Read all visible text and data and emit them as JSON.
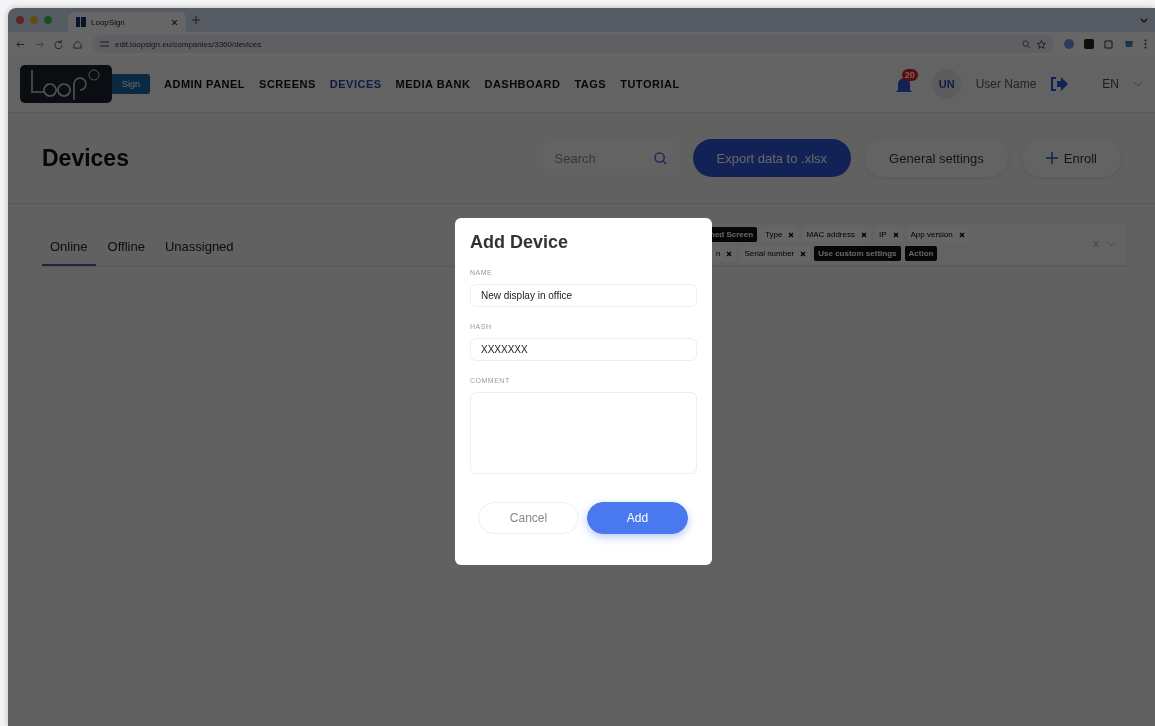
{
  "browser": {
    "tab_title": "LoopSign",
    "url": "edit.loopsign.eu/companies/3360/devices"
  },
  "header": {
    "logo_badge": "Sign",
    "nav": [
      {
        "label": "ADMIN PANEL",
        "selected": false
      },
      {
        "label": "SCREENS",
        "selected": false
      },
      {
        "label": "DEVICES",
        "selected": true
      },
      {
        "label": "MEDIA BANK",
        "selected": false
      },
      {
        "label": "DASHBOARD",
        "selected": false
      },
      {
        "label": "TAGS",
        "selected": false
      },
      {
        "label": "TUTORIAL",
        "selected": false
      }
    ],
    "notification_count": "20",
    "user_initials": "UN",
    "user_name": "User Name",
    "language": "EN"
  },
  "page": {
    "title": "Devices",
    "search": {
      "placeholder": "Search"
    },
    "buttons": [
      {
        "label": "Export data to .xlsx",
        "kind": "primary"
      },
      {
        "label": "General settings",
        "kind": "secondary"
      },
      {
        "label": "Enroll",
        "kind": "add"
      }
    ]
  },
  "tabs": [
    {
      "label": "Online",
      "selected": true
    },
    {
      "label": "Offline",
      "selected": false
    },
    {
      "label": "Unassigned",
      "selected": false
    }
  ],
  "column_chips": [
    [
      {
        "label": "ned Screen",
        "kind": "dark"
      },
      {
        "label": "Type",
        "kind": "removable"
      },
      {
        "label": "MAC address",
        "kind": "removable"
      },
      {
        "label": "IP",
        "kind": "removable"
      },
      {
        "label": "App version",
        "kind": "removable"
      }
    ],
    [
      {
        "label": "n",
        "kind": "removable"
      },
      {
        "label": "Serial number",
        "kind": "removable"
      },
      {
        "label": "Use custom settings",
        "kind": "dark"
      },
      {
        "label": "Action",
        "kind": "dark"
      }
    ]
  ],
  "dialog": {
    "title": "Add Device",
    "fields": [
      {
        "label": "NAME",
        "value": "New display in office",
        "kind": "input"
      },
      {
        "label": "HASH",
        "value": "XXXXXXX",
        "kind": "input"
      },
      {
        "label": "COMMENT",
        "kind": "textarea"
      }
    ],
    "buttons": [
      {
        "label": "Cancel",
        "kind": "secondary"
      },
      {
        "label": "Add",
        "kind": "primary"
      }
    ]
  }
}
